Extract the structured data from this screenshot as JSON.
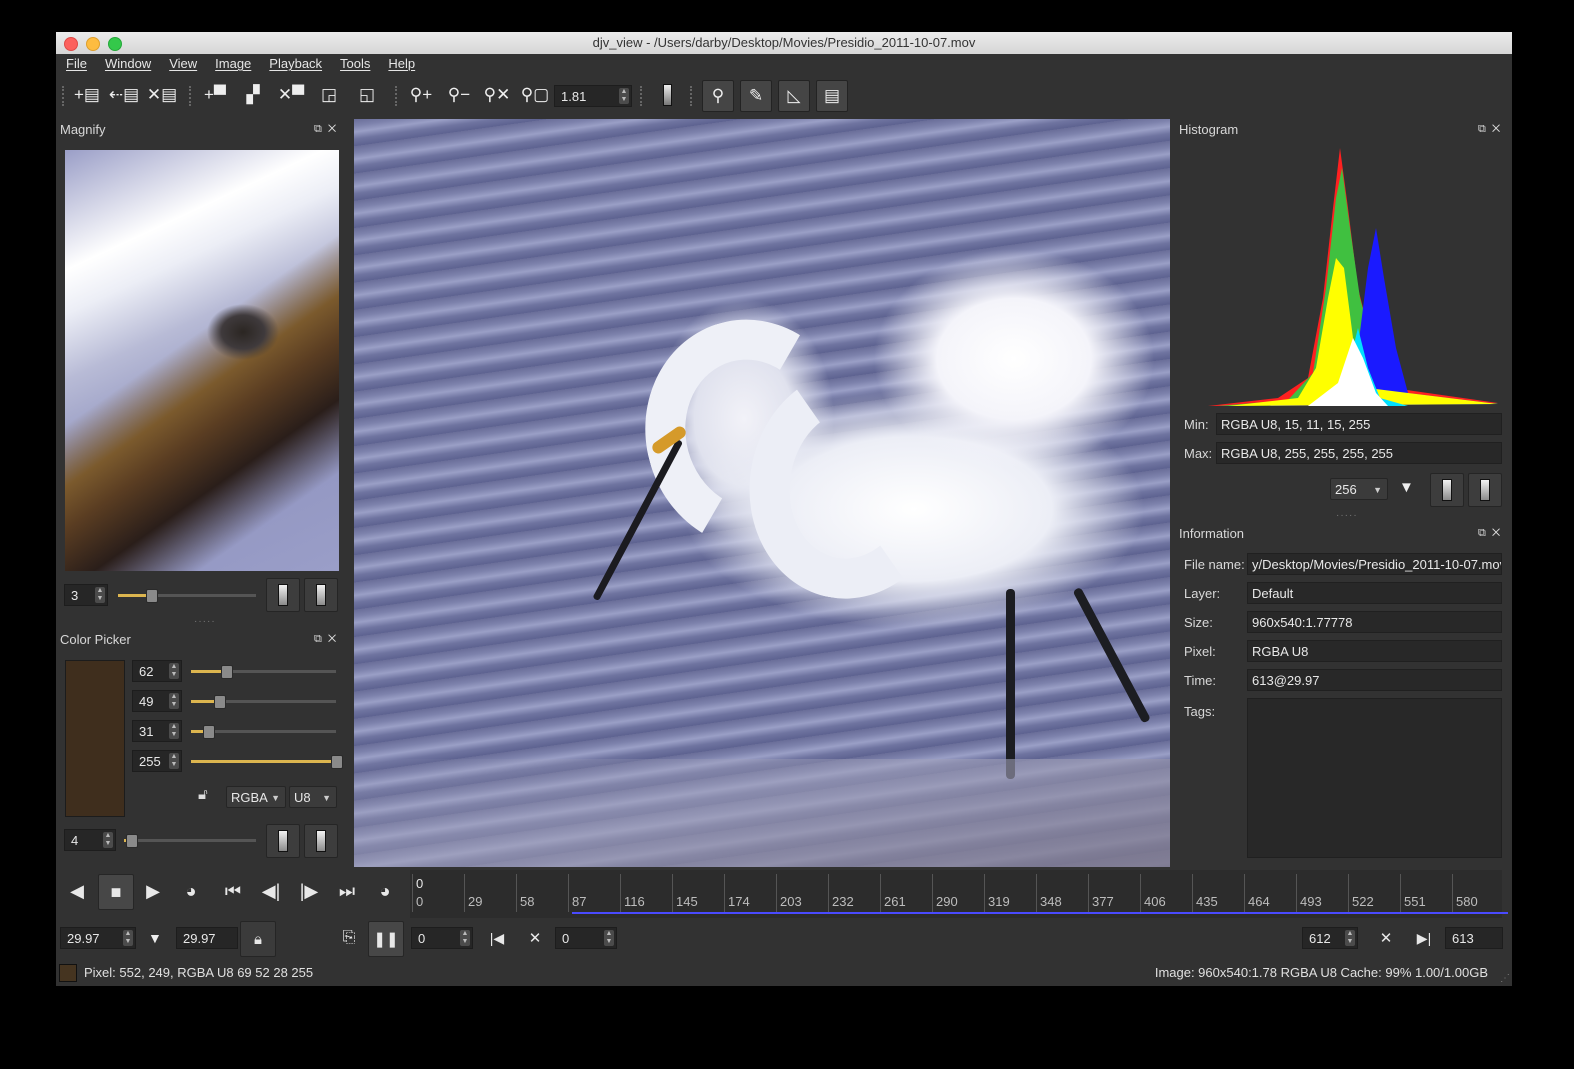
{
  "window": {
    "title": "djv_view - /Users/darby/Desktop/Movies/Presidio_2011-10-07.mov"
  },
  "menu": [
    "File",
    "Window",
    "View",
    "Image",
    "Playback",
    "Tools",
    "Help"
  ],
  "toolbar": {
    "zoom_value": "1.81"
  },
  "magnify": {
    "title": "Magnify",
    "zoom_value": "3",
    "slider_level": 0.24
  },
  "color_picker": {
    "title": "Color Picker",
    "swatch_color": "#3f2e1d",
    "channels": [
      {
        "value": "62",
        "level": 0.24
      },
      {
        "value": "49",
        "level": 0.19
      },
      {
        "value": "31",
        "level": 0.12
      },
      {
        "value": "255",
        "level": 1.0
      }
    ],
    "format": "RGBA",
    "type": "U8",
    "sample_value": "4",
    "sample_level": 0.05
  },
  "histogram": {
    "title": "Histogram",
    "min_label": "Min:",
    "min_value": "RGBA U8, 15, 11, 15, 255",
    "max_label": "Max:",
    "max_value": "RGBA U8, 255, 255, 255, 255",
    "bins": "256"
  },
  "information": {
    "title": "Information",
    "rows": [
      {
        "label": "File name:",
        "value": "y/Desktop/Movies/Presidio_2011-10-07.mov"
      },
      {
        "label": "Layer:",
        "value": "Default"
      },
      {
        "label": "Size:",
        "value": "960x540:1.77778"
      },
      {
        "label": "Pixel:",
        "value": "RGBA U8"
      },
      {
        "label": "Time:",
        "value": "613@29.97"
      }
    ],
    "tags_label": "Tags:"
  },
  "timeline": {
    "top_frame": "0",
    "frames": [
      "0",
      "29",
      "58",
      "87",
      "116",
      "145",
      "174",
      "203",
      "232",
      "261",
      "290",
      "319",
      "348",
      "377",
      "406",
      "435",
      "464",
      "493",
      "522",
      "551",
      "580"
    ],
    "cached_start_frame": 87,
    "cached_end_frame": 609
  },
  "playback": {
    "speed": "29.97",
    "actual_speed": "29.97",
    "frame": "0",
    "in_point": "0",
    "out_point": "612",
    "end_frame": "613"
  },
  "status": {
    "pixel_swatch": "#453420",
    "pixel": "Pixel: 552, 249, RGBA U8 69 52 28 255",
    "image": "Image: 960x540:1.78 RGBA U8  Cache: 99% 1.00/1.00GB"
  }
}
